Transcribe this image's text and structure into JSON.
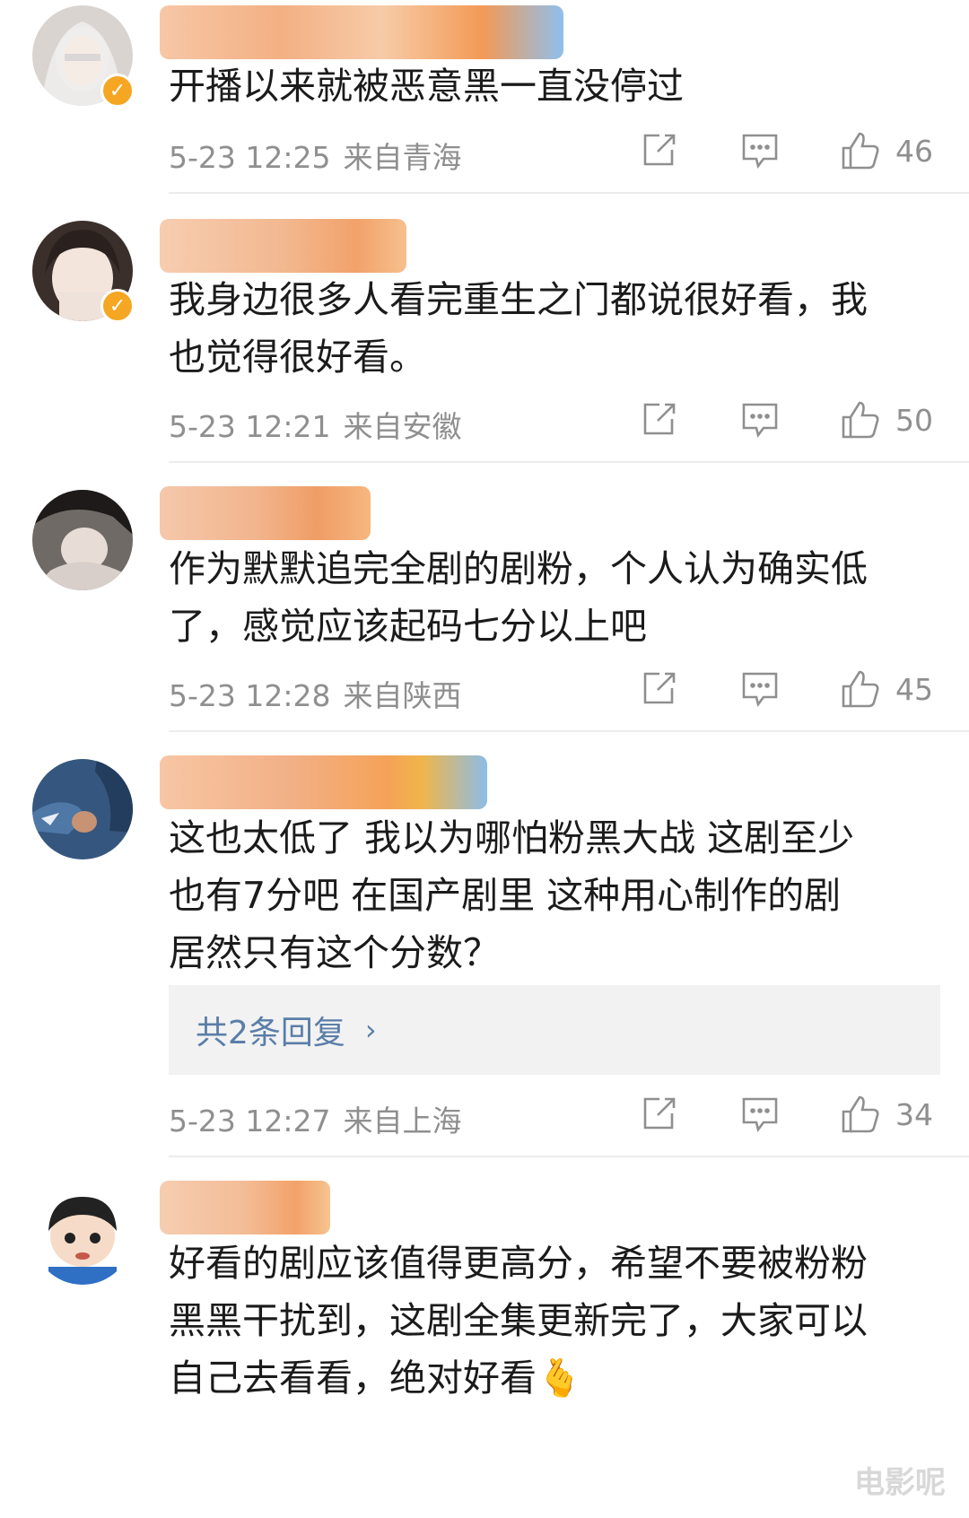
{
  "comments": [
    {
      "text": "开播以来就被恶意黑一直没停过",
      "date": "5-23 12:25",
      "location": "来自青海",
      "likes": "46",
      "verified": true
    },
    {
      "text": "我身边很多人看完重生之门都说很好看，我也觉得很好看。",
      "date": "5-23 12:21",
      "location": "来自安徽",
      "likes": "50",
      "verified": true
    },
    {
      "text": "作为默默追完全剧的剧粉，个人认为确实低了，感觉应该起码七分以上吧",
      "date": "5-23 12:28",
      "location": "来自陕西",
      "likes": "45",
      "verified": false
    },
    {
      "text": "这也太低了 我以为哪怕粉黑大战 这剧至少也有7分吧 在国产剧里 这种用心制作的剧居然只有这个分数？",
      "replies": "共2条回复",
      "date": "5-23 12:27",
      "location": "来自上海",
      "likes": "34",
      "verified": false
    },
    {
      "text": "好看的剧应该值得更高分，希望不要被粉粉黑黑干扰到，这剧全集更新完了，大家可以自己去看看，绝对好看🫰",
      "verified": false
    }
  ],
  "watermark": "电影呢",
  "colors": {
    "meta": "#8f8f8f",
    "reply_link": "#5a7ea8",
    "badge": "#f5a623",
    "divider": "#ececec"
  }
}
